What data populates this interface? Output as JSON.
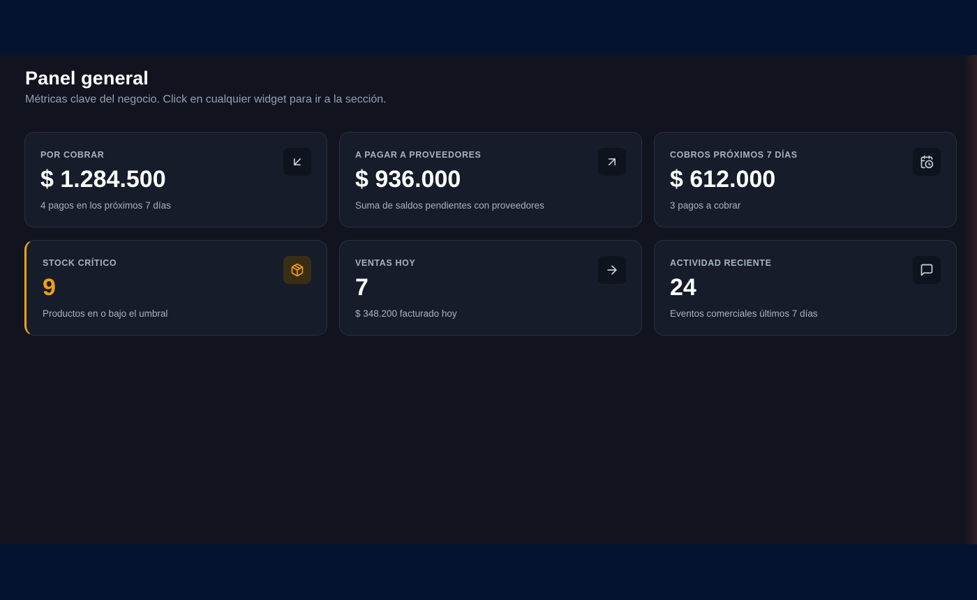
{
  "header": {
    "title": "Panel general",
    "subtitle": "Métricas clave del negocio. Click en cualquier widget para ir a la sección."
  },
  "colors": {
    "background": "#11141f",
    "card": "#161c2a",
    "accent_warning": "#f0a015",
    "muted_text": "#a7b2c4"
  },
  "widgets": [
    {
      "label": "POR COBRAR",
      "value": "$ 1.284.500",
      "caption": "4 pagos en los próximos 7 días",
      "icon": "arrow-down-left-icon"
    },
    {
      "label": "A PAGAR A PROVEEDORES",
      "value": "$ 936.000",
      "caption": "Suma de saldos pendientes con proveedores",
      "icon": "arrow-up-right-icon"
    },
    {
      "label": "COBROS PRÓXIMOS 7 DÍAS",
      "value": "$ 612.000",
      "caption": "3 pagos a cobrar",
      "icon": "calendar-clock-icon"
    },
    {
      "label": "STOCK CRÍTICO",
      "value": "9",
      "caption": "Productos en o bajo el umbral",
      "icon": "package-icon",
      "status": "warning"
    },
    {
      "label": "VENTAS HOY",
      "value": "7",
      "caption": "$ 348.200 facturado hoy",
      "icon": "arrow-right-icon"
    },
    {
      "label": "ACTIVIDAD RECIENTE",
      "value": "24",
      "caption": "Eventos comerciales últimos 7 días",
      "icon": "message-square-icon"
    }
  ]
}
